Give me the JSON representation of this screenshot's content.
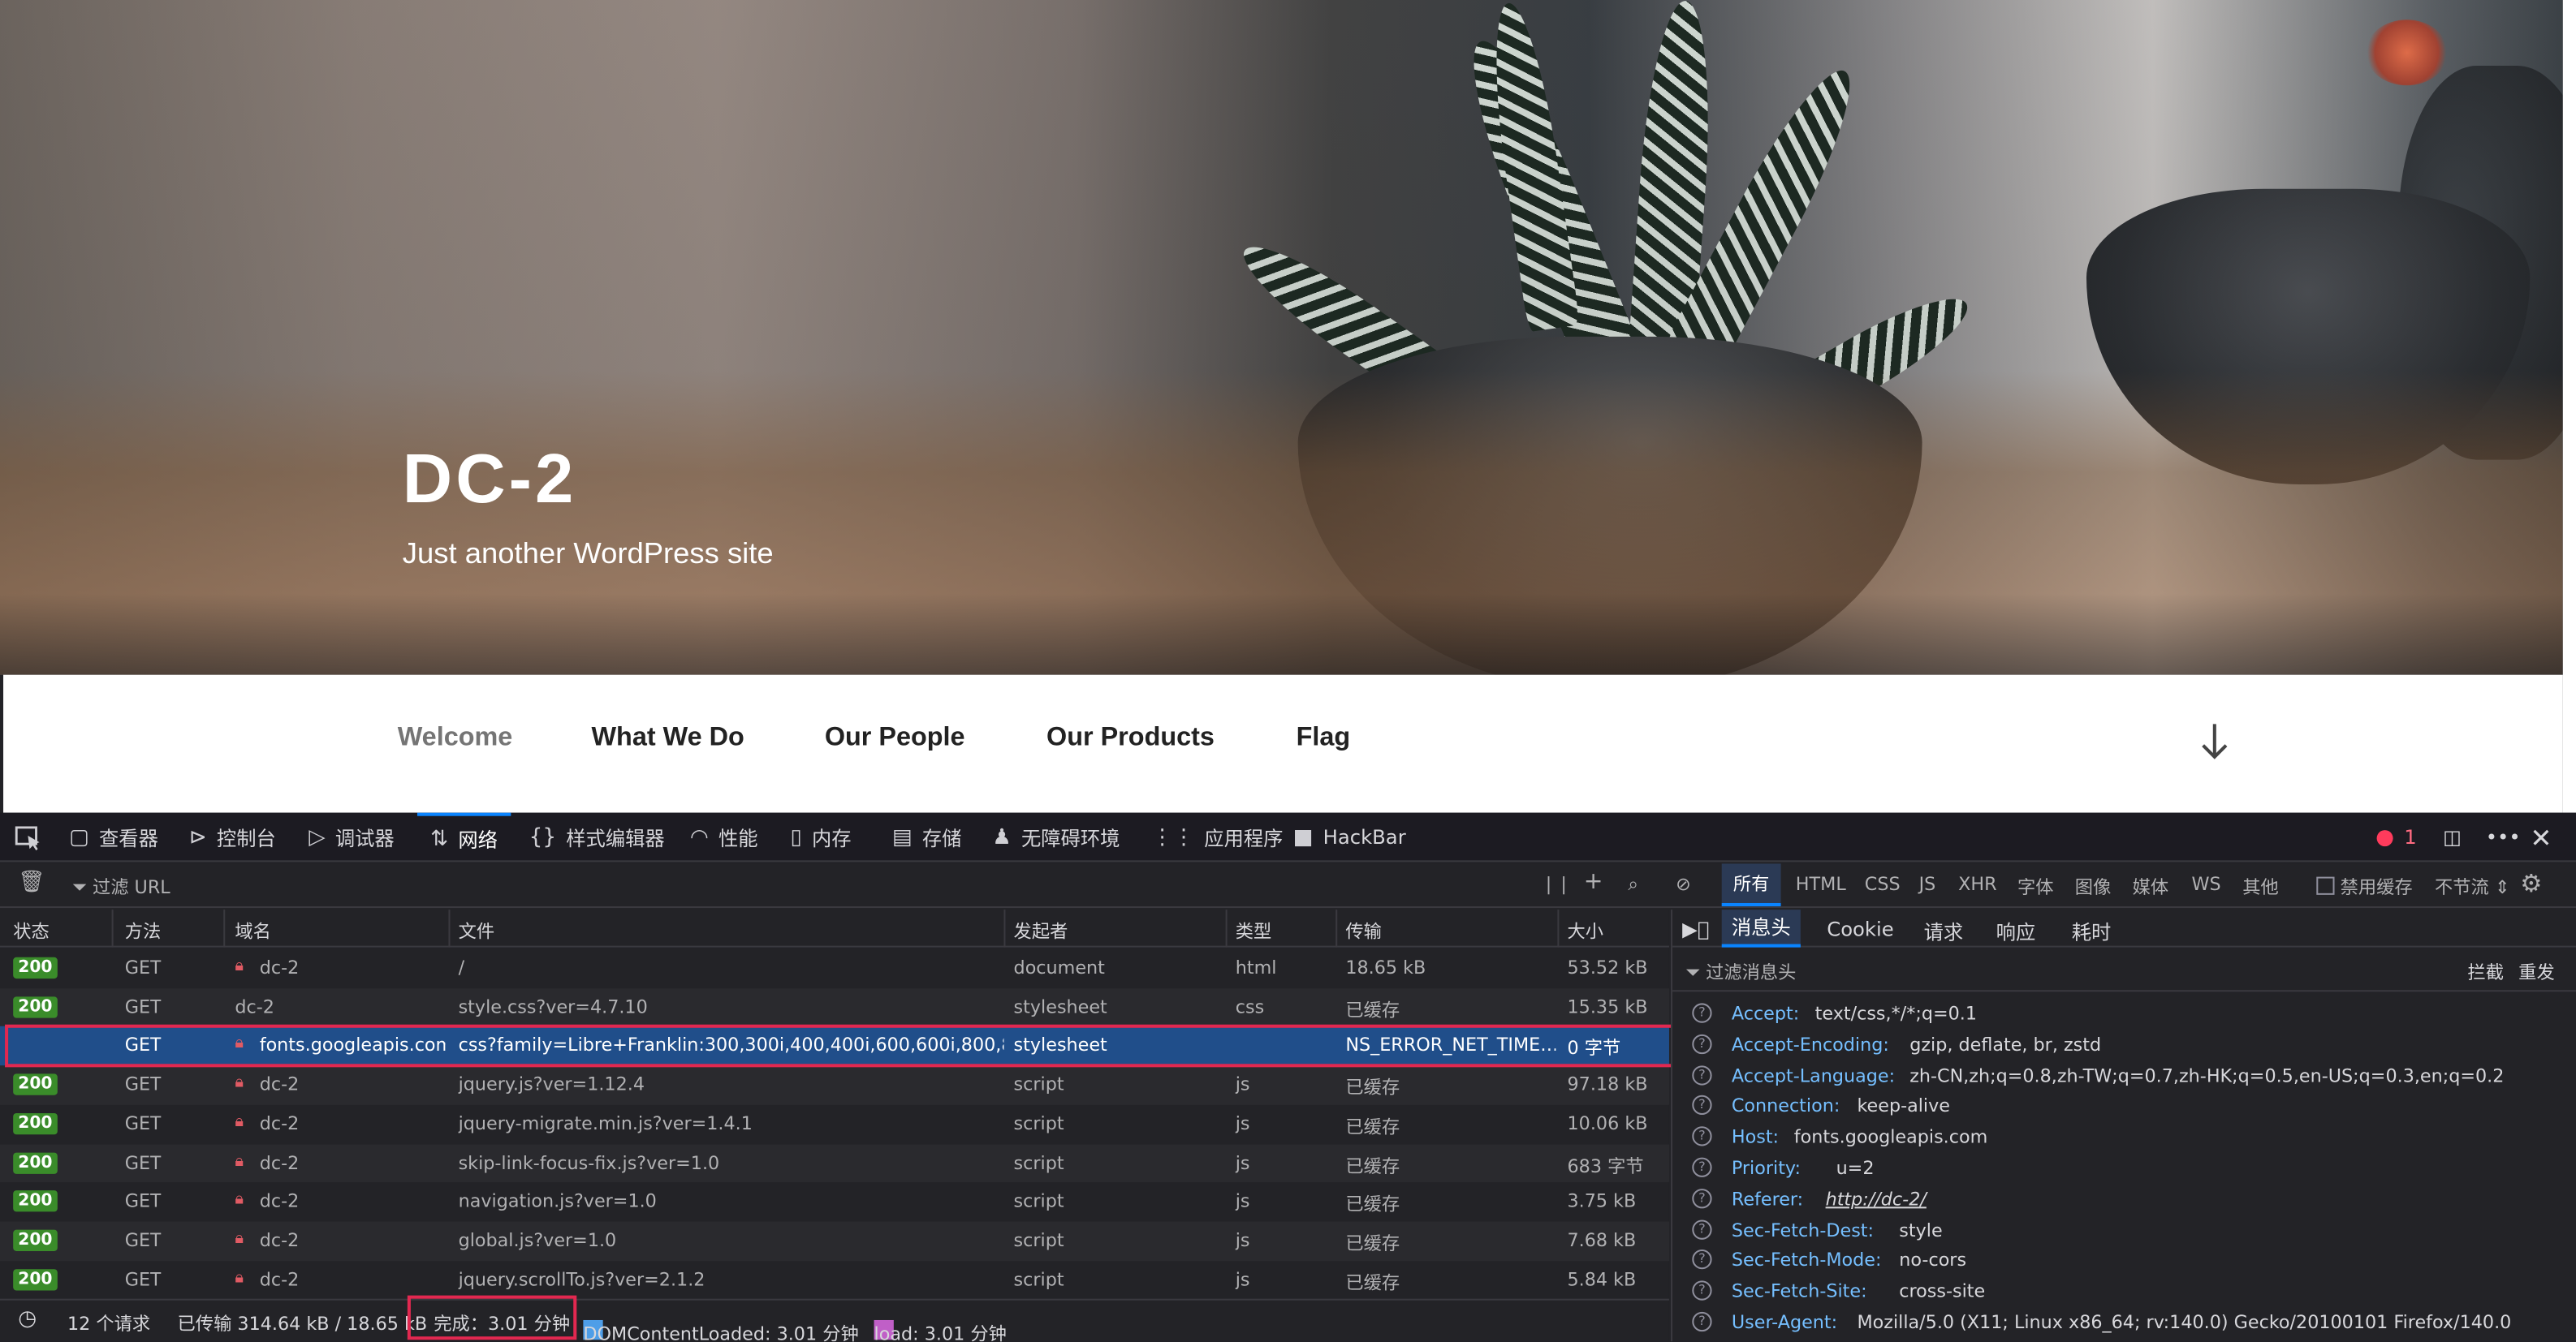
{
  "site": {
    "title": "DC-2",
    "tagline": "Just another WordPress site",
    "menu": [
      "Welcome",
      "What We Do",
      "Our People",
      "Our Products",
      "Flag"
    ]
  },
  "devtools": {
    "tabs": [
      "查看器",
      "控制台",
      "调试器",
      "网络",
      "样式编辑器",
      "性能",
      "内存",
      "存储",
      "无障碍环境",
      "应用程序",
      "HackBar"
    ],
    "selected_tab": "网络",
    "error_count": "1",
    "filter_placeholder": "过滤 URL",
    "type_filters": [
      "所有",
      "HTML",
      "CSS",
      "JS",
      "XHR",
      "字体",
      "图像",
      "媒体",
      "WS",
      "其他"
    ],
    "disable_cache": "禁用缓存",
    "throttle": "不节流 ⇕",
    "columns": [
      "状态",
      "方法",
      "域名",
      "文件",
      "发起者",
      "类型",
      "传输",
      "大小"
    ],
    "rows": [
      {
        "status": "200",
        "method": "GET",
        "domain": "dc-2",
        "file": "/",
        "initiator": "document",
        "type": "html",
        "transfer": "18.65 kB",
        "size": "53.52 kB"
      },
      {
        "status": "200",
        "method": "GET",
        "domain": "dc-2",
        "file": "style.css?ver=4.7.10",
        "initiator": "stylesheet",
        "type": "css",
        "transfer": "已缓存",
        "size": "15.35 kB"
      },
      {
        "status": "",
        "method": "GET",
        "domain": "fonts.googleapis.com",
        "file": "css?family=Libre+Franklin:300,300i,400,400i,600,600i,800,800i&su",
        "initiator": "stylesheet",
        "type": "",
        "transfer": "NS_ERROR_NET_TIME…",
        "size": "0 字节"
      },
      {
        "status": "200",
        "method": "GET",
        "domain": "dc-2",
        "file": "jquery.js?ver=1.12.4",
        "initiator": "script",
        "type": "js",
        "transfer": "已缓存",
        "size": "97.18 kB"
      },
      {
        "status": "200",
        "method": "GET",
        "domain": "dc-2",
        "file": "jquery-migrate.min.js?ver=1.4.1",
        "initiator": "script",
        "type": "js",
        "transfer": "已缓存",
        "size": "10.06 kB"
      },
      {
        "status": "200",
        "method": "GET",
        "domain": "dc-2",
        "file": "skip-link-focus-fix.js?ver=1.0",
        "initiator": "script",
        "type": "js",
        "transfer": "已缓存",
        "size": "683 字节"
      },
      {
        "status": "200",
        "method": "GET",
        "domain": "dc-2",
        "file": "navigation.js?ver=1.0",
        "initiator": "script",
        "type": "js",
        "transfer": "已缓存",
        "size": "3.75 kB"
      },
      {
        "status": "200",
        "method": "GET",
        "domain": "dc-2",
        "file": "global.js?ver=1.0",
        "initiator": "script",
        "type": "js",
        "transfer": "已缓存",
        "size": "7.68 kB"
      },
      {
        "status": "200",
        "method": "GET",
        "domain": "dc-2",
        "file": "jquery.scrollTo.js?ver=2.1.2",
        "initiator": "script",
        "type": "js",
        "transfer": "已缓存",
        "size": "5.84 kB"
      }
    ],
    "status_bar": {
      "requests": "12 个请求",
      "transferred": "已传输 314.64 kB / 18.65 kB",
      "finish": "完成：3.01 分钟",
      "dcl": "DOMContentLoaded: 3.01 分钟",
      "load": "load: 3.01 分钟"
    },
    "side_tabs": [
      "消息头",
      "Cookie",
      "请求",
      "响应",
      "耗时"
    ],
    "side_filter": "过滤消息头",
    "side_actions": [
      "拦截",
      "重发"
    ],
    "headers": [
      {
        "k": "Accept:",
        "v": "text/css,*/*;q=0.1"
      },
      {
        "k": "Accept-Encoding:",
        "v": "gzip, deflate, br, zstd"
      },
      {
        "k": "Accept-Language:",
        "v": "zh-CN,zh;q=0.8,zh-TW;q=0.7,zh-HK;q=0.5,en-US;q=0.3,en;q=0.2"
      },
      {
        "k": "Connection:",
        "v": "keep-alive"
      },
      {
        "k": "Host:",
        "v": "fonts.googleapis.com"
      },
      {
        "k": "Priority:",
        "v": "u=2"
      },
      {
        "k": "Referer:",
        "v": "http://dc-2/"
      },
      {
        "k": "Sec-Fetch-Dest:",
        "v": "style"
      },
      {
        "k": "Sec-Fetch-Mode:",
        "v": "no-cors"
      },
      {
        "k": "Sec-Fetch-Site:",
        "v": "cross-site"
      },
      {
        "k": "User-Agent:",
        "v": "Mozilla/5.0 (X11; Linux x86_64; rv:140.0) Gecko/20100101 Firefox/140.0"
      }
    ]
  }
}
